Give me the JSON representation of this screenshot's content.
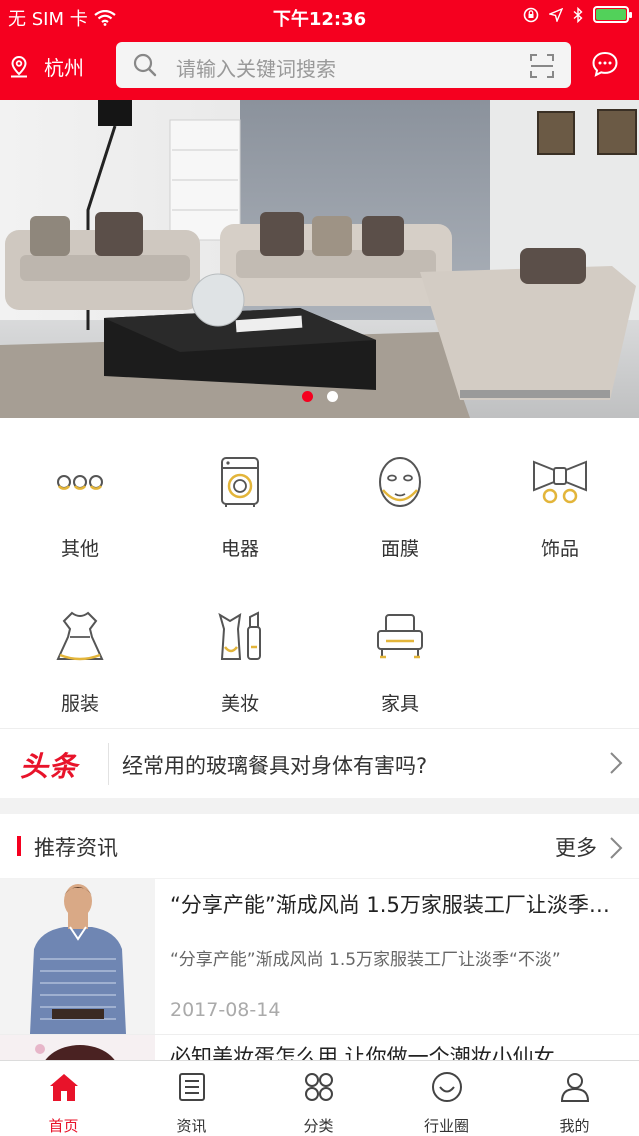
{
  "status_bar": {
    "carrier": "无 SIM 卡",
    "time": "下午12:36"
  },
  "header": {
    "location": "杭州",
    "search_placeholder": "请输入关键词搜索"
  },
  "banner": {
    "slide_count": 2,
    "active_index": 0
  },
  "categories": [
    {
      "label": "其他",
      "icon": "more-dots-icon"
    },
    {
      "label": "电器",
      "icon": "washing-machine-icon"
    },
    {
      "label": "面膜",
      "icon": "face-mask-icon"
    },
    {
      "label": "饰品",
      "icon": "bow-accessory-icon"
    },
    {
      "label": "服装",
      "icon": "dress-icon"
    },
    {
      "label": "美妆",
      "icon": "cosmetics-icon"
    },
    {
      "label": "家具",
      "icon": "armchair-icon"
    }
  ],
  "headline": {
    "tag": "头条",
    "text": "经常用的玻璃餐具对身体有害吗?"
  },
  "recommended": {
    "title": "推荐资讯",
    "more": "更多",
    "items": [
      {
        "title": "“分享产能”渐成风尚 1.5万家服装工厂让淡季“不淡”",
        "summary": "“分享产能”渐成风尚 1.5万家服装工厂让淡季“不淡”",
        "date": "2017-08-14"
      },
      {
        "title": "必知美妆蛋怎么用 让你做一个潮妆小仙女",
        "summary": "",
        "date": ""
      }
    ]
  },
  "tabbar": [
    {
      "label": "首页",
      "icon": "home-icon",
      "active": true
    },
    {
      "label": "资讯",
      "icon": "news-icon",
      "active": false
    },
    {
      "label": "分类",
      "icon": "category-icon",
      "active": false
    },
    {
      "label": "行业圈",
      "icon": "smile-circle-icon",
      "active": false
    },
    {
      "label": "我的",
      "icon": "user-icon",
      "active": false
    }
  ],
  "colors": {
    "brand_red": "#f5001f",
    "icon_gold": "#e3b53a"
  }
}
